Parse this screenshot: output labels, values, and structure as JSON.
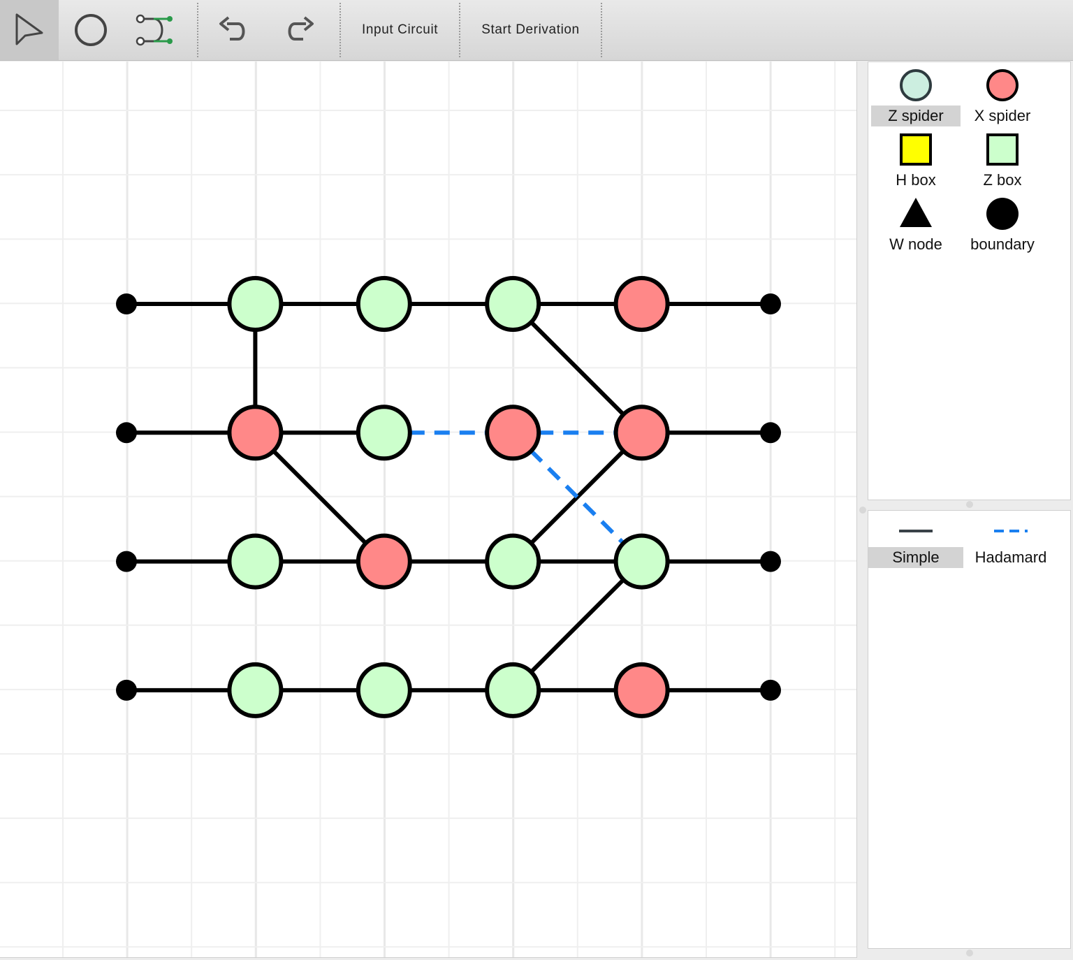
{
  "toolbar": {
    "tools": [
      {
        "name": "select-tool",
        "icon": "cursor-arrow-icon",
        "active": true
      },
      {
        "name": "vertex-tool",
        "icon": "circle-icon",
        "active": false
      },
      {
        "name": "edge-tool",
        "icon": "edge-connect-icon",
        "active": false
      }
    ],
    "undo_icon": "undo-icon",
    "redo_icon": "redo-icon",
    "input_circuit_label": "Input Circuit",
    "start_derivation_label": "Start Derivation"
  },
  "colors": {
    "z_spider": "#ccffcc",
    "x_spider": "#ff8888",
    "z_spider_palette": "#cceee0",
    "h_box": "#ffff00",
    "z_box": "#ccffcc",
    "hadamard_edge": "#1a7ff0",
    "simple_edge": "#000000"
  },
  "vertex_palette": [
    {
      "label": "Z spider",
      "shape": "circle",
      "fill": "#cceee0",
      "selected": true
    },
    {
      "label": "X spider",
      "shape": "circle",
      "fill": "#ff8888",
      "selected": false
    },
    {
      "label": "H box",
      "shape": "square",
      "fill": "#ffff00",
      "selected": false
    },
    {
      "label": "Z box",
      "shape": "square",
      "fill": "#ccffcc",
      "selected": false
    },
    {
      "label": "W node",
      "shape": "triangle",
      "fill": "#000000",
      "selected": false
    },
    {
      "label": "boundary",
      "shape": "dot",
      "fill": "#000000",
      "selected": false
    }
  ],
  "edge_palette": [
    {
      "label": "Simple",
      "style": "solid",
      "selected": true
    },
    {
      "label": "Hadamard",
      "style": "dashed",
      "selected": false
    }
  ],
  "graph": {
    "vertices": [
      {
        "id": "b0",
        "type": "boundary",
        "row": 0,
        "col": 0
      },
      {
        "id": "b1",
        "type": "boundary",
        "row": 1,
        "col": 0
      },
      {
        "id": "b2",
        "type": "boundary",
        "row": 2,
        "col": 0
      },
      {
        "id": "b3",
        "type": "boundary",
        "row": 3,
        "col": 0
      },
      {
        "id": "v01",
        "type": "Z",
        "row": 0,
        "col": 1
      },
      {
        "id": "v02",
        "type": "Z",
        "row": 0,
        "col": 2
      },
      {
        "id": "v03",
        "type": "Z",
        "row": 0,
        "col": 3
      },
      {
        "id": "v04",
        "type": "X",
        "row": 0,
        "col": 4
      },
      {
        "id": "v11",
        "type": "X",
        "row": 1,
        "col": 1
      },
      {
        "id": "v12",
        "type": "Z",
        "row": 1,
        "col": 2
      },
      {
        "id": "v13",
        "type": "X",
        "row": 1,
        "col": 3
      },
      {
        "id": "v14",
        "type": "X",
        "row": 1,
        "col": 4
      },
      {
        "id": "v21",
        "type": "Z",
        "row": 2,
        "col": 1
      },
      {
        "id": "v22",
        "type": "X",
        "row": 2,
        "col": 2
      },
      {
        "id": "v23",
        "type": "Z",
        "row": 2,
        "col": 3
      },
      {
        "id": "v24",
        "type": "Z",
        "row": 2,
        "col": 4
      },
      {
        "id": "v31",
        "type": "Z",
        "row": 3,
        "col": 1
      },
      {
        "id": "v32",
        "type": "Z",
        "row": 3,
        "col": 2
      },
      {
        "id": "v33",
        "type": "Z",
        "row": 3,
        "col": 3
      },
      {
        "id": "v34",
        "type": "X",
        "row": 3,
        "col": 4
      },
      {
        "id": "e0",
        "type": "boundary",
        "row": 0,
        "col": 5
      },
      {
        "id": "e1",
        "type": "boundary",
        "row": 1,
        "col": 5
      },
      {
        "id": "e2",
        "type": "boundary",
        "row": 2,
        "col": 5
      },
      {
        "id": "e3",
        "type": "boundary",
        "row": 3,
        "col": 5
      }
    ],
    "edges": [
      {
        "from": "b0",
        "to": "v01",
        "kind": "simple"
      },
      {
        "from": "v01",
        "to": "v02",
        "kind": "simple"
      },
      {
        "from": "v02",
        "to": "v03",
        "kind": "simple"
      },
      {
        "from": "v03",
        "to": "v04",
        "kind": "simple"
      },
      {
        "from": "v04",
        "to": "e0",
        "kind": "simple"
      },
      {
        "from": "b1",
        "to": "v11",
        "kind": "simple"
      },
      {
        "from": "v11",
        "to": "v12",
        "kind": "simple"
      },
      {
        "from": "v12",
        "to": "v13",
        "kind": "hadamard"
      },
      {
        "from": "v13",
        "to": "v14",
        "kind": "hadamard"
      },
      {
        "from": "v14",
        "to": "e1",
        "kind": "simple"
      },
      {
        "from": "b2",
        "to": "v21",
        "kind": "simple"
      },
      {
        "from": "v21",
        "to": "v22",
        "kind": "simple"
      },
      {
        "from": "v22",
        "to": "v23",
        "kind": "simple"
      },
      {
        "from": "v23",
        "to": "v24",
        "kind": "simple"
      },
      {
        "from": "v24",
        "to": "e2",
        "kind": "simple"
      },
      {
        "from": "b3",
        "to": "v31",
        "kind": "simple"
      },
      {
        "from": "v31",
        "to": "v32",
        "kind": "simple"
      },
      {
        "from": "v32",
        "to": "v33",
        "kind": "simple"
      },
      {
        "from": "v33",
        "to": "v34",
        "kind": "simple"
      },
      {
        "from": "v34",
        "to": "e3",
        "kind": "simple"
      },
      {
        "from": "v01",
        "to": "v11",
        "kind": "simple"
      },
      {
        "from": "v11",
        "to": "v22",
        "kind": "simple"
      },
      {
        "from": "v03",
        "to": "v14",
        "kind": "simple"
      },
      {
        "from": "v14",
        "to": "v23",
        "kind": "simple"
      },
      {
        "from": "v13",
        "to": "v24",
        "kind": "hadamard"
      },
      {
        "from": "v24",
        "to": "v33",
        "kind": "simple"
      }
    ]
  }
}
